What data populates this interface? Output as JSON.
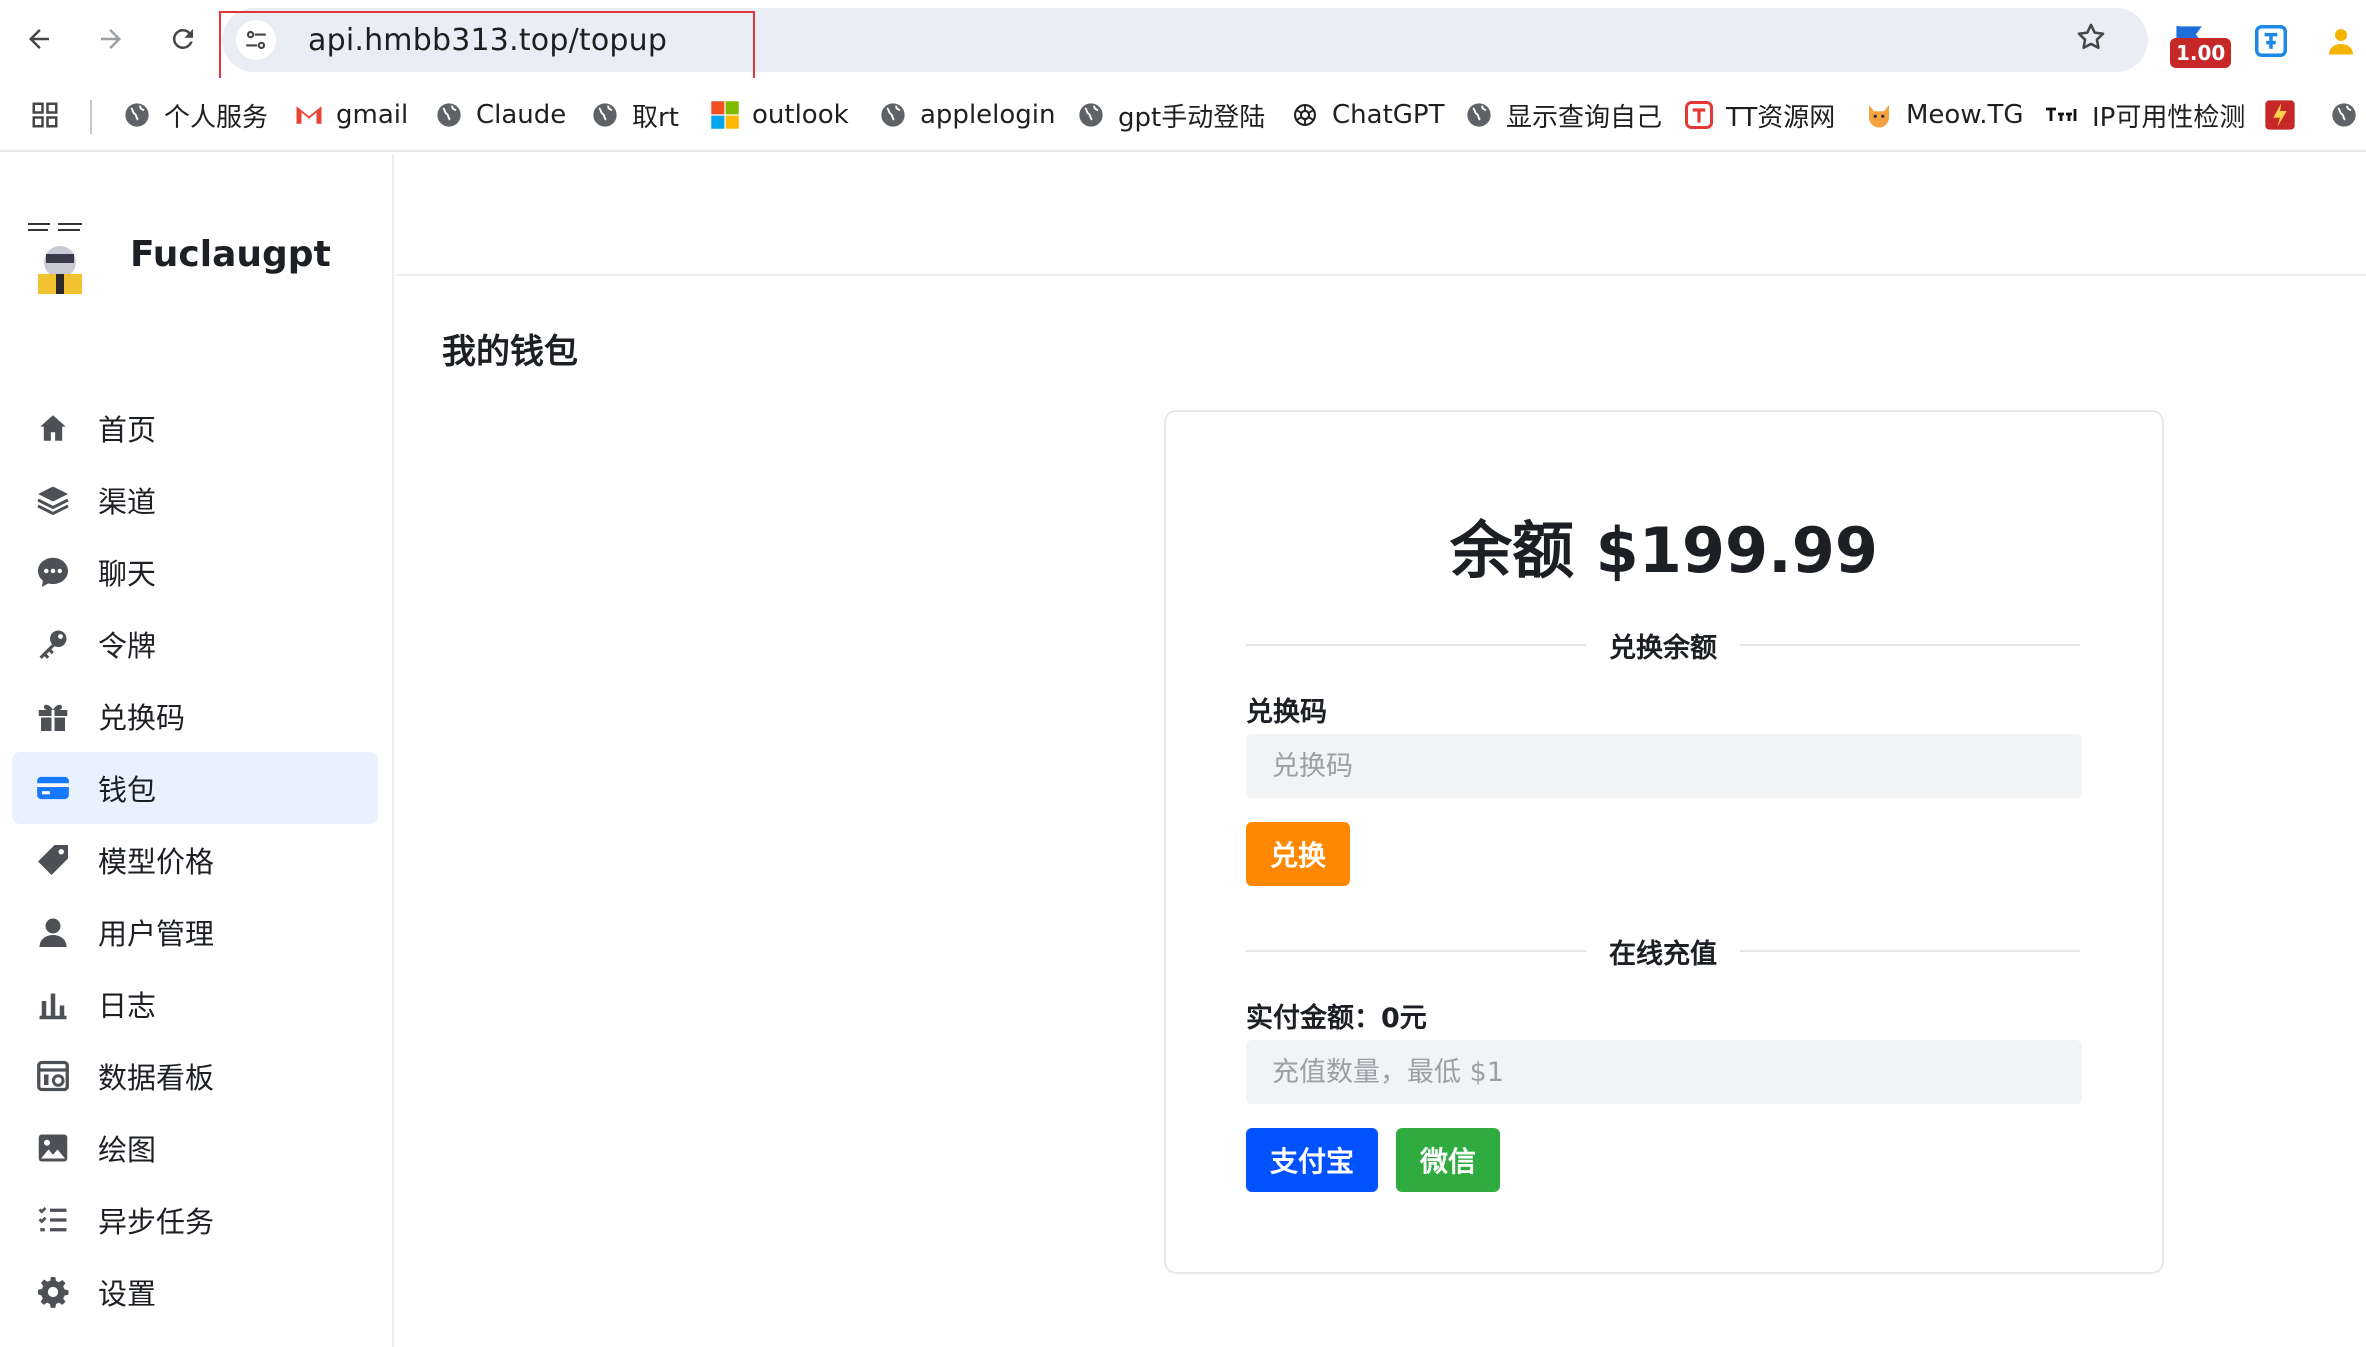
{
  "browser": {
    "url": "api.hmbb313.top/topup",
    "extension_badge": "1.00",
    "bookmarks": [
      {
        "label": "个人服务",
        "icon": "globe-icon"
      },
      {
        "label": "gmail",
        "icon": "gmail-icon"
      },
      {
        "label": "Claude",
        "icon": "globe-icon"
      },
      {
        "label": "取rt",
        "icon": "globe-icon"
      },
      {
        "label": "outlook",
        "icon": "microsoft-icon"
      },
      {
        "label": "applelogin",
        "icon": "globe-icon"
      },
      {
        "label": "gpt手动登陆",
        "icon": "globe-icon"
      },
      {
        "label": "ChatGPT",
        "icon": "openai-icon"
      },
      {
        "label": "显示查询自己",
        "icon": "globe-icon"
      },
      {
        "label": "TT资源网",
        "icon": "tt-icon"
      },
      {
        "label": "Meow.TG",
        "icon": "cat-icon"
      },
      {
        "label": "IP可用性检测",
        "icon": "tools-icon"
      }
    ]
  },
  "app": {
    "name": "Fuclaugpt",
    "menu": [
      {
        "label": "首页",
        "icon": "home-icon"
      },
      {
        "label": "渠道",
        "icon": "layers-icon"
      },
      {
        "label": "聊天",
        "icon": "chat-icon"
      },
      {
        "label": "令牌",
        "icon": "key-icon"
      },
      {
        "label": "兑换码",
        "icon": "gift-icon"
      },
      {
        "label": "钱包",
        "icon": "wallet-icon",
        "active": true
      },
      {
        "label": "模型价格",
        "icon": "price-tag-icon"
      },
      {
        "label": "用户管理",
        "icon": "user-icon"
      },
      {
        "label": "日志",
        "icon": "bar-chart-icon"
      },
      {
        "label": "数据看板",
        "icon": "dashboard-icon"
      },
      {
        "label": "绘图",
        "icon": "image-icon"
      },
      {
        "label": "异步任务",
        "icon": "task-list-icon"
      },
      {
        "label": "设置",
        "icon": "gear-icon"
      }
    ]
  },
  "wallet": {
    "page_title": "我的钱包",
    "balance": "余额 $199.99",
    "redeem_section": "兑换余额",
    "redeem_label": "兑换码",
    "redeem_placeholder": "兑换码",
    "redeem_button": "兑换",
    "topup_section": "在线充值",
    "pay_amount_label": "实付金额：0元",
    "topup_placeholder": "充值数量，最低 $1",
    "alipay_button": "支付宝",
    "wechat_button": "微信"
  },
  "colors": {
    "accent": "#1677ff",
    "active_bg": "#e8f2ff",
    "redeem_button": "#ff8800",
    "alipay_button": "#0052ff",
    "wechat_button": "#2fab3f",
    "url_highlight": "#e3343b"
  }
}
